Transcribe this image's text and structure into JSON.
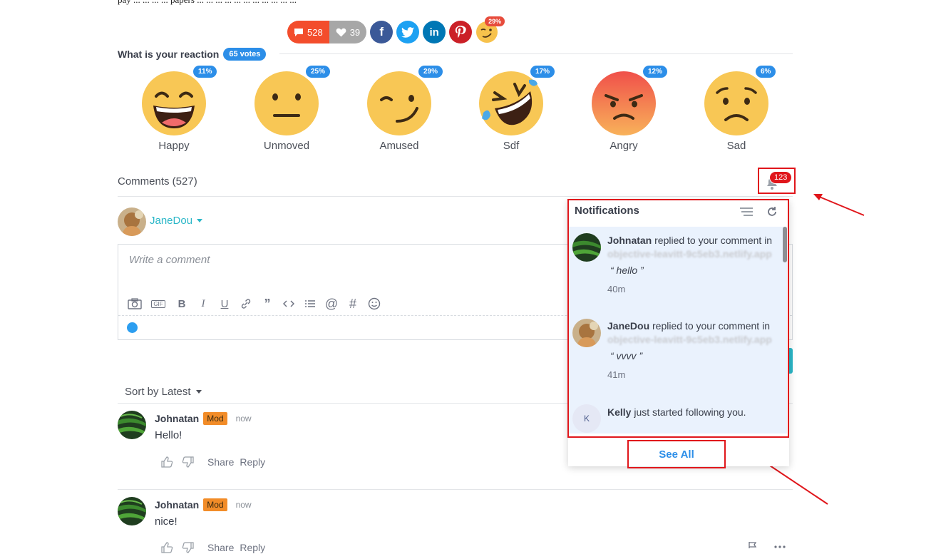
{
  "top_text": "pay ... ... ... ... papers ... ... ... ... ... ... ... ... ... ... ...",
  "share_bar": {
    "comments_count": "528",
    "likes_count": "39",
    "top_reaction_percent": "29%"
  },
  "reactions": {
    "title": "What is your reaction",
    "votes": "65 votes",
    "items": [
      {
        "label": "Happy",
        "percent": "11%"
      },
      {
        "label": "Unmoved",
        "percent": "25%"
      },
      {
        "label": "Amused",
        "percent": "29%"
      },
      {
        "label": "Sdf",
        "percent": "17%"
      },
      {
        "label": "Angry",
        "percent": "12%"
      },
      {
        "label": "Sad",
        "percent": "6%"
      }
    ]
  },
  "comments_header": {
    "title": "Comments (527)",
    "notification_count": "123"
  },
  "current_user": {
    "name": "JaneDou"
  },
  "editor": {
    "placeholder": "Write a comment",
    "gif_label": "GIF"
  },
  "sort": {
    "label": "Sort by Latest"
  },
  "comments": [
    {
      "author": "Johnatan",
      "badge": "Mod",
      "time": "now",
      "text": "Hello!",
      "share": "Share",
      "reply": "Reply"
    },
    {
      "author": "Johnatan",
      "badge": "Mod",
      "time": "now",
      "text": "nice!",
      "share": "Share",
      "reply": "Reply"
    }
  ],
  "notifications": {
    "title": "Notifications",
    "items": [
      {
        "actor": "Johnatan",
        "action": "replied to your comment in",
        "site": "objective-leavitt-9c5eb3.netlify.app",
        "quote": "“ hello ”",
        "ago": "40m"
      },
      {
        "actor": "JaneDou",
        "action": "replied to your comment in",
        "site": "objective-leavitt-9c5eb3.netlify.app",
        "quote": "“ vvvv ”",
        "ago": "41m"
      },
      {
        "actor": "Kelly",
        "action": "just started following you.",
        "avatar_letter": "K"
      }
    ],
    "see_all": "See All"
  },
  "colors": {
    "accent_blue": "#2c8ee8",
    "teal": "#2bb7c8",
    "highlight_red": "#e0161b",
    "mod_badge": "#f28c28"
  }
}
